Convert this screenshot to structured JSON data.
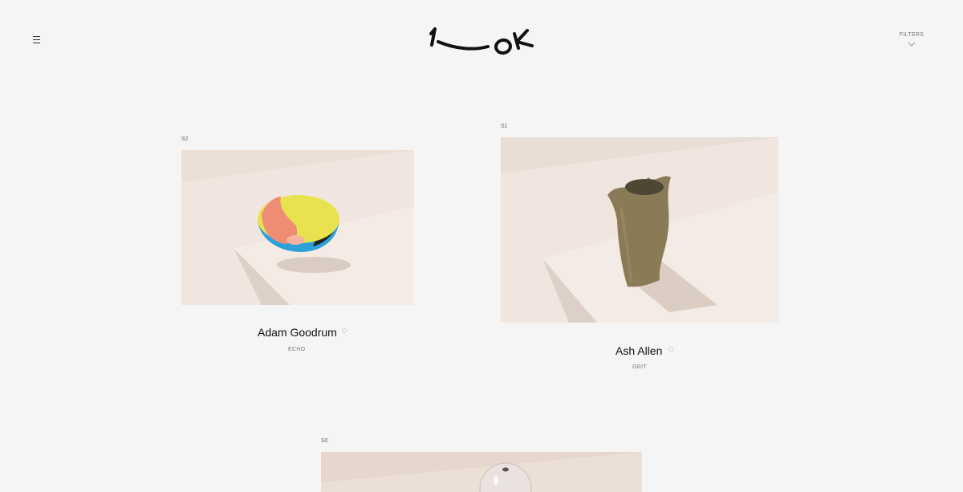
{
  "header": {
    "menu_icon": "hamburger-menu-icon",
    "logo_text": "1—OK",
    "filters_label": "FILTERS",
    "filters_icon": "chevron-down-icon"
  },
  "products": [
    {
      "index": "S2",
      "designer": "Adam Goodrum",
      "series": "ECHO",
      "image": "multicolour-bowl-on-plinth",
      "background": "#ece0d8"
    },
    {
      "index": "S1",
      "designer": "Ash Allen",
      "series": "GRIT",
      "image": "textured-vase-on-plinth",
      "background": "#ebe1da"
    },
    {
      "index": "S0",
      "designer": "",
      "series": "",
      "image": "glass-sphere-on-plinth",
      "background": "#e6d8cf"
    }
  ],
  "colors": {
    "page_background": "#f5f5f5",
    "text": "#111111",
    "muted_text": "#777777"
  }
}
